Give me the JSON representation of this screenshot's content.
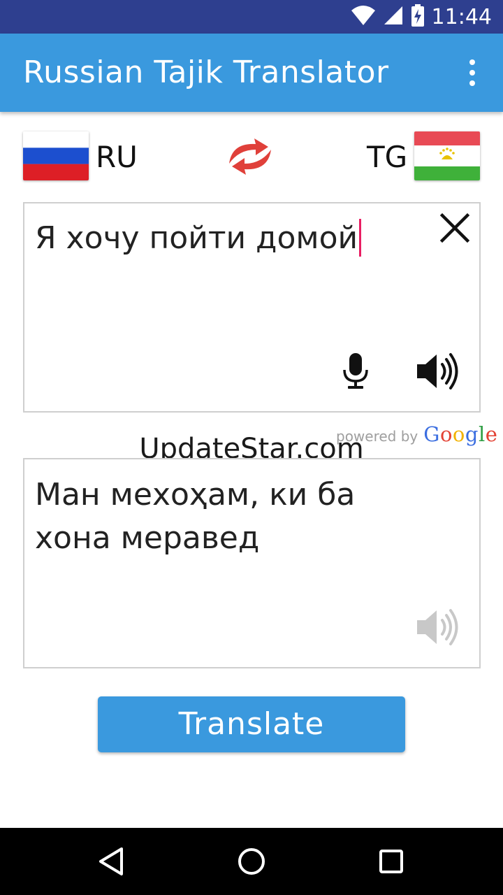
{
  "status_bar": {
    "time": "11:44"
  },
  "app_bar": {
    "title": "Russian Tajik Translator",
    "menu_icon": "more-vert-icon"
  },
  "languages": {
    "source_code": "RU",
    "target_code": "TG",
    "swap_icon": "swap-arrows-icon"
  },
  "input": {
    "text": "Я хочу пойти домой"
  },
  "attribution": {
    "powered_by": "powered by",
    "google": [
      "G",
      "o",
      "o",
      "g",
      "l",
      "e"
    ]
  },
  "watermark": "UpdateStar.com",
  "output": {
    "text": "Ман мехоҳам, ки ба хона меравед"
  },
  "actions": {
    "translate_label": "Translate"
  },
  "colors": {
    "primary": "#3a99de",
    "status_bar": "#2e3f8f",
    "swap_red": "#e0403a",
    "caret": "#e91e63"
  }
}
